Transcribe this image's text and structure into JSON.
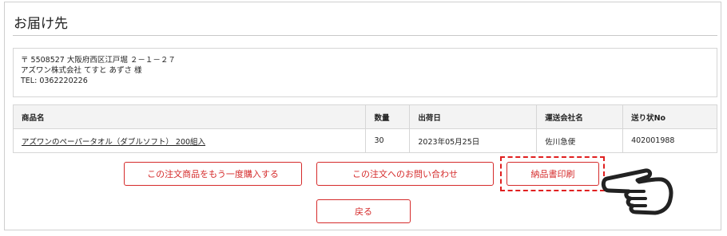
{
  "section": {
    "title": "お届け先"
  },
  "address": {
    "postal_line": "〒 5508527 大阪府西区江戸堀 ２－１－２７",
    "name_line": "アズワン株式会社 てすと あずさ 様",
    "tel_line": "TEL: 0362220226"
  },
  "table": {
    "headers": [
      "商品名",
      "数量",
      "出荷日",
      "運送会社名",
      "送り状No"
    ],
    "row": {
      "product": "アズワンのペーパータオル（ダブルソフト） 200組入",
      "quantity": "30",
      "ship_date": "2023年05月25日",
      "carrier": "佐川急便",
      "tracking_no": "402001988"
    }
  },
  "buttons": {
    "reorder": "この注文商品をもう一度購入する",
    "inquiry": "この注文へのお問い合わせ",
    "print_invoice": "納品書印刷",
    "back": "戻る"
  },
  "colors": {
    "accent": "#d52b2b",
    "highlight": "#e02020",
    "header_bg": "#f3f3f3",
    "border": "#d6d6d6"
  },
  "icons": {
    "pointer": "pointing-hand-icon"
  }
}
